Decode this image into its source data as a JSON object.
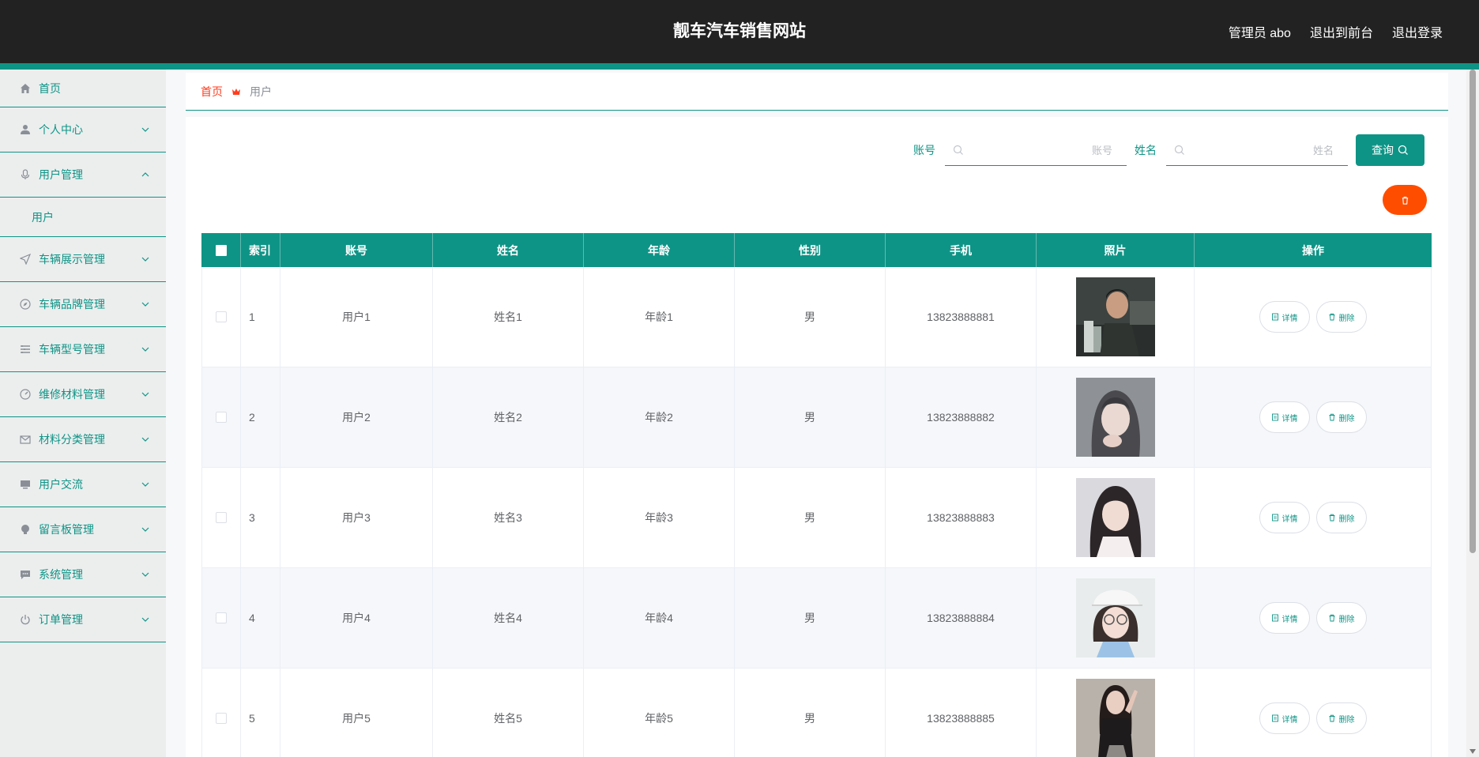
{
  "header": {
    "title": "靓车汽车销售网站",
    "links": [
      "管理员 abo",
      "退出到前台",
      "退出登录"
    ]
  },
  "sidebar": {
    "items": [
      {
        "label": "首页",
        "icon": "home-icon"
      },
      {
        "label": "个人中心",
        "icon": "user-icon"
      },
      {
        "label": "用户管理",
        "icon": "microphone-icon",
        "expanded": true,
        "sub": [
          "用户"
        ]
      },
      {
        "label": "车辆展示管理",
        "icon": "navigation-icon"
      },
      {
        "label": "车辆品牌管理",
        "icon": "compass-icon"
      },
      {
        "label": "车辆型号管理",
        "icon": "list-icon"
      },
      {
        "label": "维修材料管理",
        "icon": "gauge-icon"
      },
      {
        "label": "材料分类管理",
        "icon": "mail-icon"
      },
      {
        "label": "用户交流",
        "icon": "monitor-icon"
      },
      {
        "label": "留言板管理",
        "icon": "bulb-icon"
      },
      {
        "label": "系统管理",
        "icon": "chat-icon"
      },
      {
        "label": "订单管理",
        "icon": "power-icon"
      }
    ]
  },
  "breadcrumb": {
    "home": "首页",
    "current": "用户"
  },
  "search": {
    "account_label": "账号",
    "account_placeholder": "账号",
    "name_label": "姓名",
    "name_placeholder": "姓名",
    "query_label": "查询"
  },
  "table": {
    "headers": [
      "索引",
      "账号",
      "姓名",
      "年龄",
      "性别",
      "手机",
      "照片",
      "操作"
    ],
    "rows": [
      {
        "index": "1",
        "account": "用户1",
        "name": "姓名1",
        "age": "年龄1",
        "sex": "男",
        "phone": "13823888881"
      },
      {
        "index": "2",
        "account": "用户2",
        "name": "姓名2",
        "age": "年龄2",
        "sex": "男",
        "phone": "13823888882"
      },
      {
        "index": "3",
        "account": "用户3",
        "name": "姓名3",
        "age": "年龄3",
        "sex": "男",
        "phone": "13823888883"
      },
      {
        "index": "4",
        "account": "用户4",
        "name": "姓名4",
        "age": "年龄4",
        "sex": "男",
        "phone": "13823888884"
      },
      {
        "index": "5",
        "account": "用户5",
        "name": "姓名5",
        "age": "年龄5",
        "sex": "男",
        "phone": "13823888885"
      }
    ],
    "detail_label": "详情",
    "delete_label": "删除"
  },
  "colors": {
    "accent": "#0e9486",
    "header_bg": "#222222",
    "danger": "#ff4d00",
    "breadcrumb_home": "#ff3d1f"
  }
}
